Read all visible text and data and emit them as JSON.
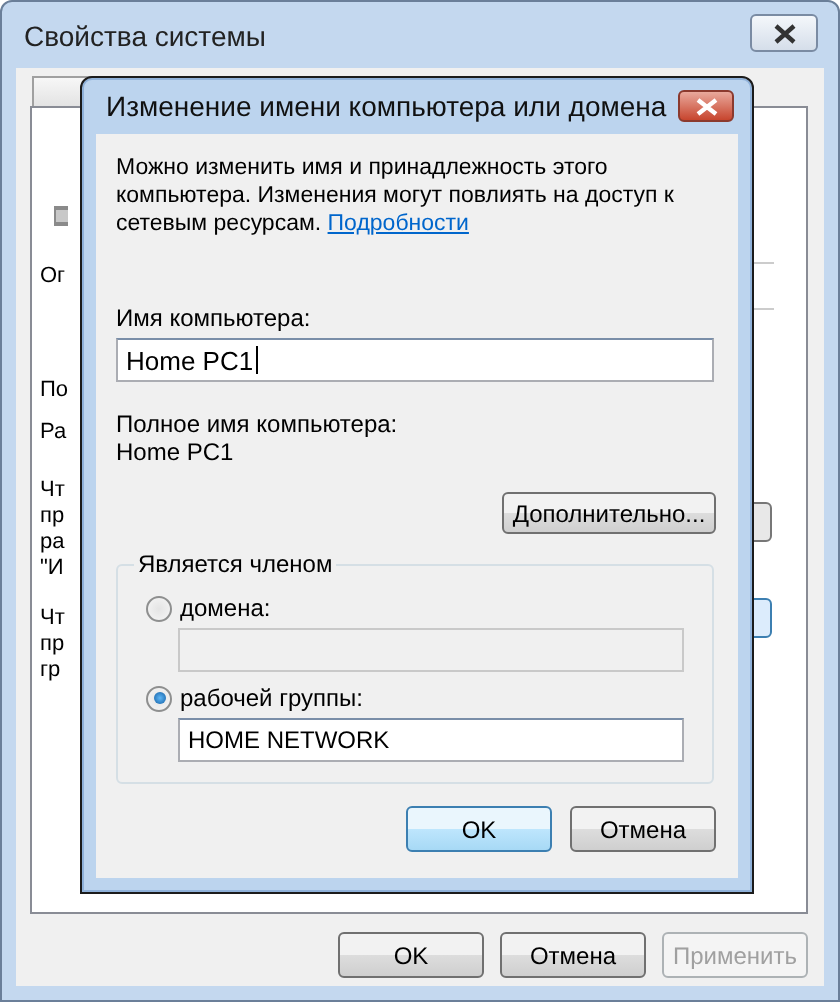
{
  "window": {
    "title": "Свойства системы"
  },
  "background_fragments": [
    [
      "Ог"
    ],
    [
      "По"
    ],
    [
      "Ра"
    ],
    [
      "Чт",
      "пр",
      "ра",
      "\"И"
    ],
    [
      "Чт",
      "пр",
      "гр"
    ]
  ],
  "dialog": {
    "title": "Изменение имени компьютера или домена",
    "intro": "Можно изменить имя и принадлежность этого компьютера. Изменения могут повлиять на доступ к сетевым ресурсам.",
    "intro_link": "Подробности",
    "name_label": "Имя компьютера:",
    "name_value": "Home PC1",
    "full_name_label": "Полное имя компьютера:",
    "full_name": "Home PC1",
    "more_button": "Дополнительно...",
    "member_legend": "Является членом",
    "member_options": [
      {
        "label": "домена:",
        "selected": false
      },
      {
        "label": "рабочей группы:",
        "selected": true,
        "value": "HOME NETWORK"
      }
    ],
    "buttons": [
      {
        "label": "OK",
        "default": true
      },
      {
        "label": "Отмена",
        "default": false
      }
    ]
  },
  "buttons": [
    {
      "label": "OK",
      "disabled": false
    },
    {
      "label": "Отмена",
      "disabled": false
    },
    {
      "label": "Применить",
      "disabled": true
    }
  ]
}
